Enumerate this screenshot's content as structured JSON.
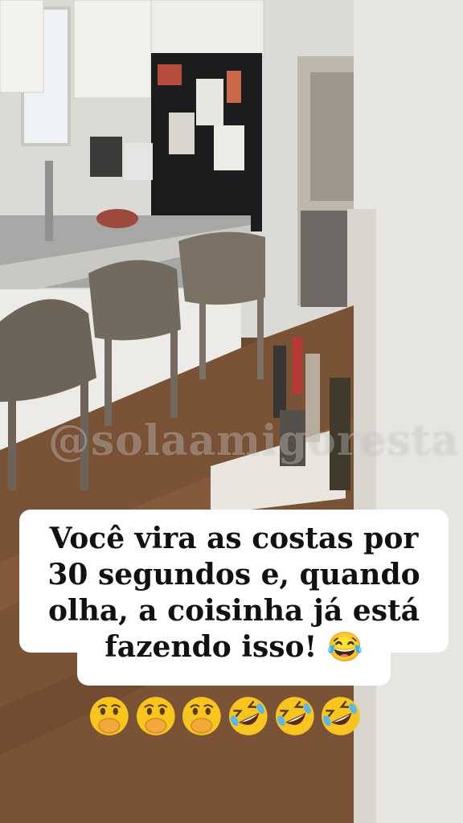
{
  "watermark": "@solaamigoresta",
  "caption": {
    "lines": [
      "Você vira as costas por",
      "30 segundos e, quando",
      "olha, a coisinha já está",
      "fazendo isso! 😂"
    ]
  },
  "emojis": [
    {
      "icon": "hand-over-mouth-emoji-icon"
    },
    {
      "icon": "hand-over-mouth-emoji-icon"
    },
    {
      "icon": "hand-over-mouth-emoji-icon"
    },
    {
      "icon": "rolling-laughing-emoji-icon"
    },
    {
      "icon": "rolling-laughing-emoji-icon"
    },
    {
      "icon": "rolling-laughing-emoji-icon"
    }
  ]
}
